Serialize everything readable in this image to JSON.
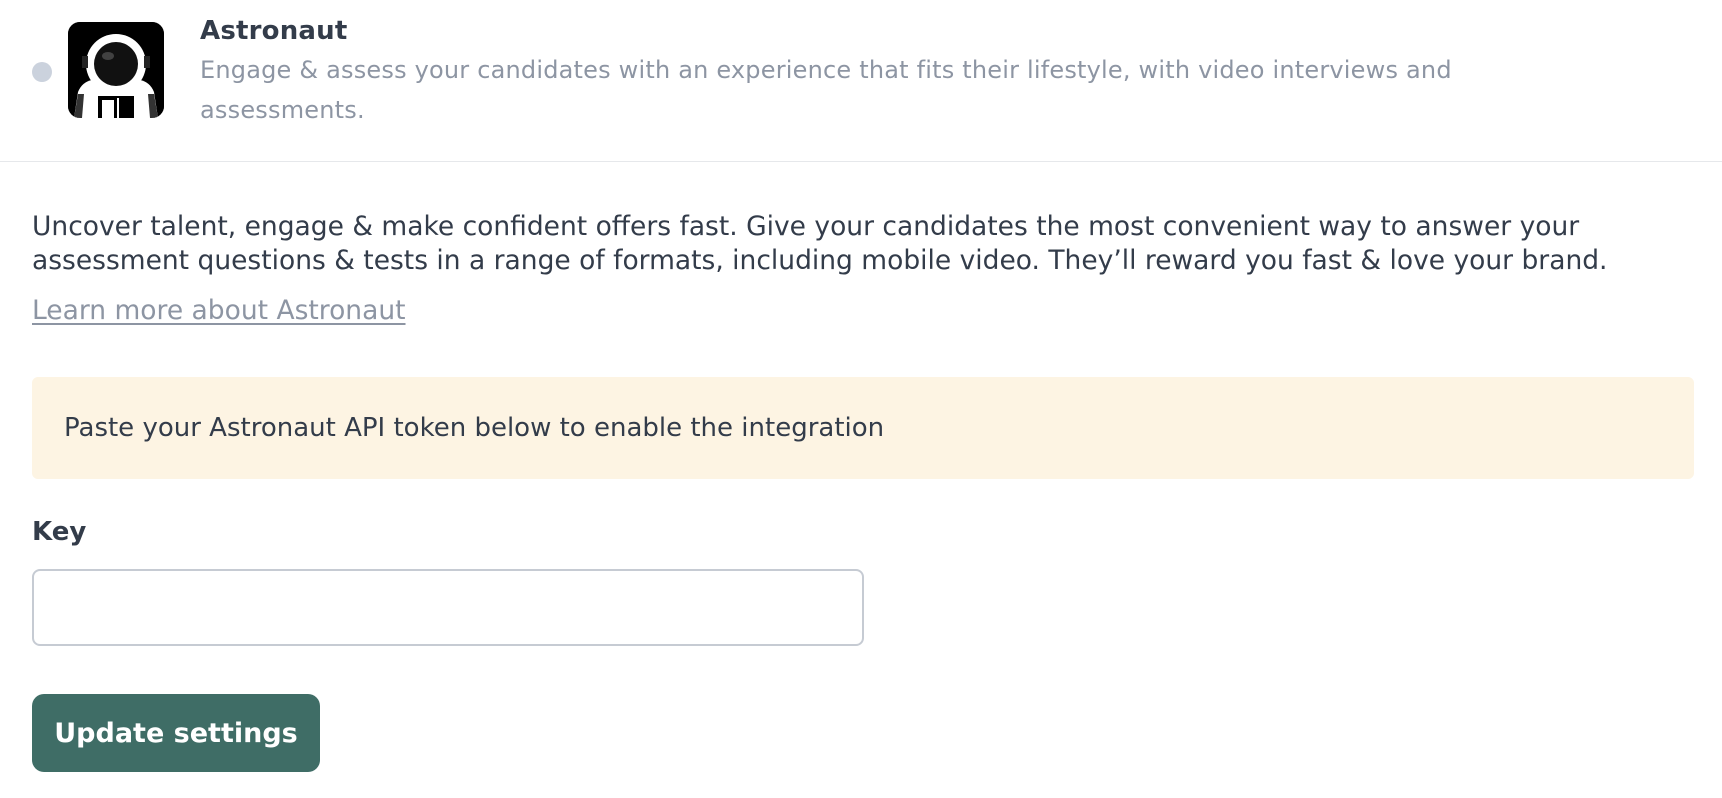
{
  "integration": {
    "name": "Astronaut",
    "tagline": "Engage & assess your candidates with an experience that fits their lifestyle, with video interviews and assessments.",
    "status_color": "#cbd2dd",
    "logo_icon": "astronaut-helmet-icon"
  },
  "details": {
    "description": "Uncover talent, engage & make confident offers fast. Give your candidates the most convenient way to answer your assessment questions & tests in a range of formats, including mobile video. They’ll reward you fast & love your brand.",
    "learn_more": "Learn more about Astronaut"
  },
  "notice": {
    "text": "Paste your Astronaut API token below to enable the integration",
    "background": "#fdf4e3"
  },
  "form": {
    "key_label": "Key",
    "key_value": "",
    "submit_label": "Update settings",
    "submit_color": "#3f6d66"
  }
}
